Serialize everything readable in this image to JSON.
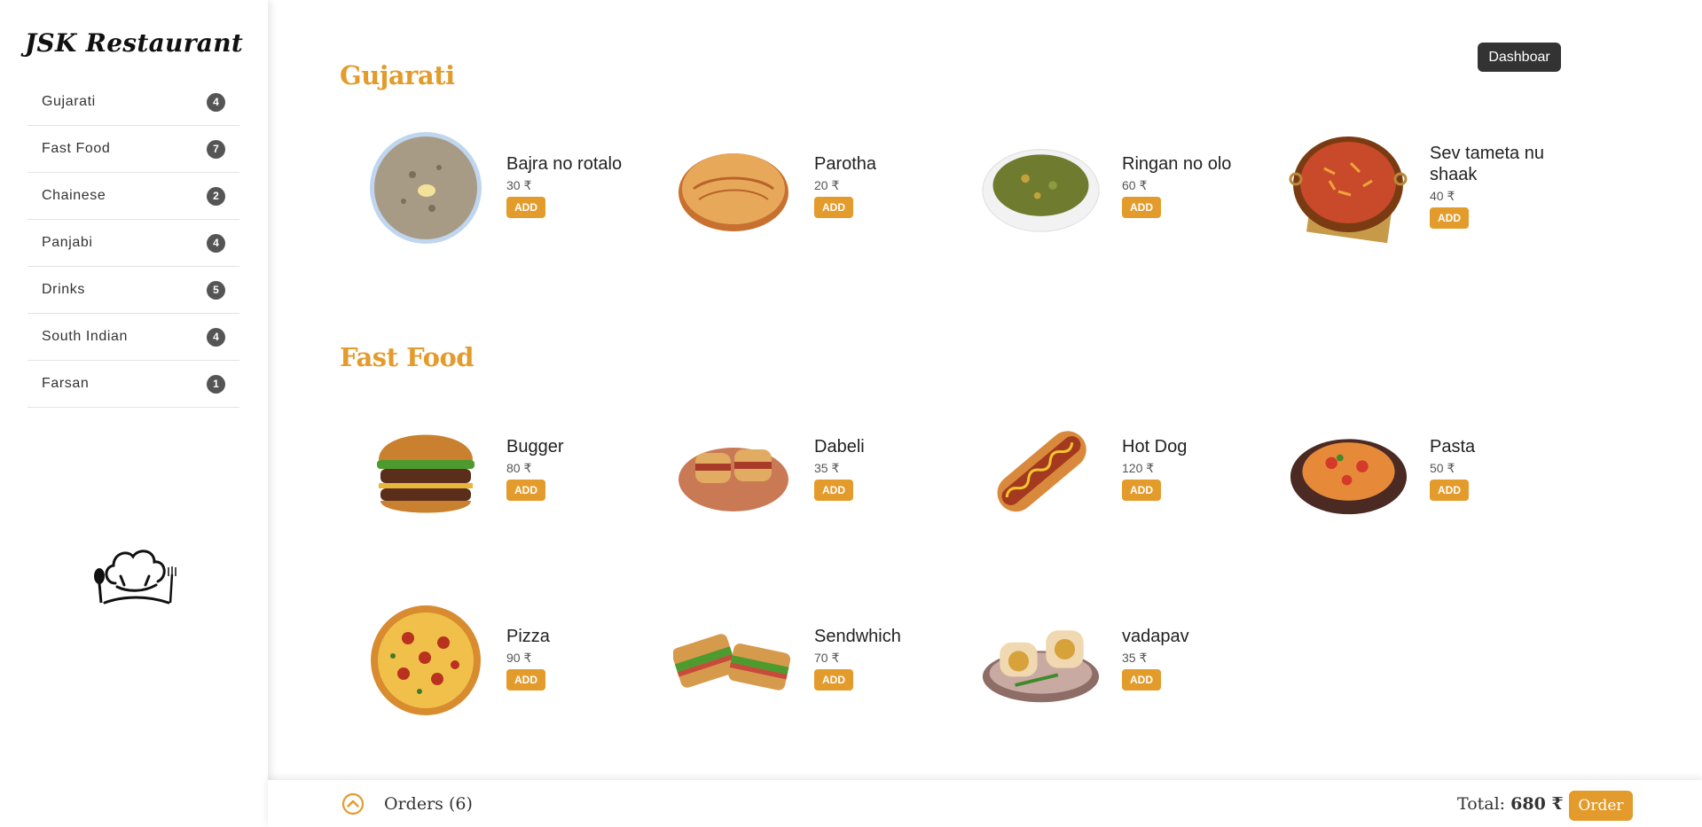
{
  "brand": "JSK Restaurant",
  "categories": [
    {
      "label": "Gujarati",
      "count": "4"
    },
    {
      "label": "Fast Food",
      "count": "7"
    },
    {
      "label": "Chainese",
      "count": "2"
    },
    {
      "label": "Panjabi",
      "count": "4"
    },
    {
      "label": "Drinks",
      "count": "5"
    },
    {
      "label": "South Indian",
      "count": "4"
    },
    {
      "label": "Farsan",
      "count": "1"
    }
  ],
  "dashboard_label": "Dashboar",
  "sections": [
    {
      "title": "Gujarati",
      "items": [
        {
          "name": "Bajra no rotalo",
          "price": "30 ₹",
          "add": "ADD"
        },
        {
          "name": "Parotha",
          "price": "20 ₹",
          "add": "ADD"
        },
        {
          "name": "Ringan no olo",
          "price": "60 ₹",
          "add": "ADD"
        },
        {
          "name": "Sev tameta nu shaak",
          "price": "40 ₹",
          "add": "ADD"
        }
      ]
    },
    {
      "title": "Fast Food",
      "items": [
        {
          "name": "Bugger",
          "price": "80 ₹",
          "add": "ADD"
        },
        {
          "name": "Dabeli",
          "price": "35 ₹",
          "add": "ADD"
        },
        {
          "name": "Hot Dog",
          "price": "120 ₹",
          "add": "ADD"
        },
        {
          "name": "Pasta",
          "price": "50 ₹",
          "add": "ADD"
        },
        {
          "name": "Pizza",
          "price": "90 ₹",
          "add": "ADD"
        },
        {
          "name": "Sendwhich",
          "price": "70 ₹",
          "add": "ADD"
        },
        {
          "name": "vadapav",
          "price": "35 ₹",
          "add": "ADD"
        }
      ]
    }
  ],
  "footer": {
    "orders_label": "Orders (6)",
    "total_label": "Total:",
    "total_value": "680 ₹",
    "order_button": "Order"
  },
  "colors": {
    "accent": "#e39b2c",
    "dark": "#333333"
  }
}
